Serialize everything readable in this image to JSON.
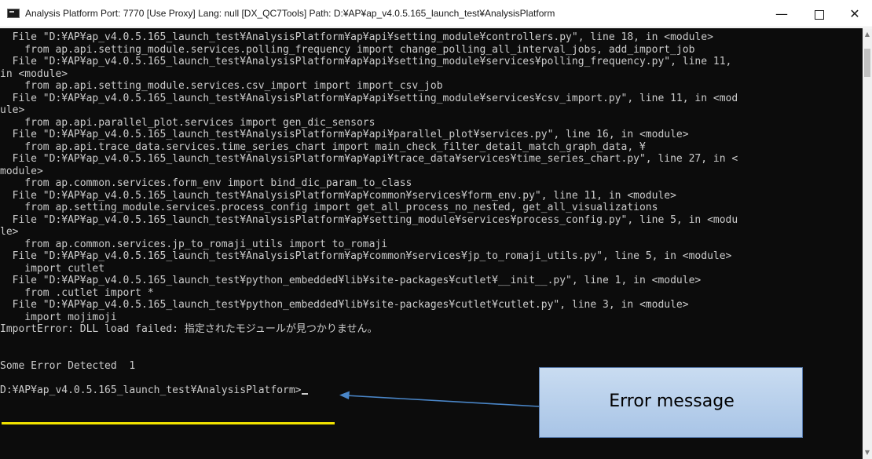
{
  "window": {
    "title": "Analysis Platform   Port: 7770 [Use Proxy]   Lang: null   [DX_QC7Tools]   Path: D:¥AP¥ap_v4.0.5.165_launch_test¥AnalysisPlatform",
    "minimize_glyph": "—",
    "close_glyph": "✕"
  },
  "terminal": {
    "lines": [
      "  File \"D:¥AP¥ap_v4.0.5.165_launch_test¥AnalysisPlatform¥ap¥api¥setting_module¥controllers.py\", line 18, in <module>",
      "    from ap.api.setting_module.services.polling_frequency import change_polling_all_interval_jobs, add_import_job",
      "  File \"D:¥AP¥ap_v4.0.5.165_launch_test¥AnalysisPlatform¥ap¥api¥setting_module¥services¥polling_frequency.py\", line 11,",
      "in <module>",
      "    from ap.api.setting_module.services.csv_import import import_csv_job",
      "  File \"D:¥AP¥ap_v4.0.5.165_launch_test¥AnalysisPlatform¥ap¥api¥setting_module¥services¥csv_import.py\", line 11, in <mod",
      "ule>",
      "    from ap.api.parallel_plot.services import gen_dic_sensors",
      "  File \"D:¥AP¥ap_v4.0.5.165_launch_test¥AnalysisPlatform¥ap¥api¥parallel_plot¥services.py\", line 16, in <module>",
      "    from ap.api.trace_data.services.time_series_chart import main_check_filter_detail_match_graph_data, ¥",
      "  File \"D:¥AP¥ap_v4.0.5.165_launch_test¥AnalysisPlatform¥ap¥api¥trace_data¥services¥time_series_chart.py\", line 27, in <",
      "module>",
      "    from ap.common.services.form_env import bind_dic_param_to_class",
      "  File \"D:¥AP¥ap_v4.0.5.165_launch_test¥AnalysisPlatform¥ap¥common¥services¥form_env.py\", line 11, in <module>",
      "    from ap.setting_module.services.process_config import get_all_process_no_nested, get_all_visualizations",
      "  File \"D:¥AP¥ap_v4.0.5.165_launch_test¥AnalysisPlatform¥ap¥setting_module¥services¥process_config.py\", line 5, in <modu",
      "le>",
      "    from ap.common.services.jp_to_romaji_utils import to_romaji",
      "  File \"D:¥AP¥ap_v4.0.5.165_launch_test¥AnalysisPlatform¥ap¥common¥services¥jp_to_romaji_utils.py\", line 5, in <module>",
      "    import cutlet",
      "  File \"D:¥AP¥ap_v4.0.5.165_launch_test¥python_embedded¥lib¥site-packages¥cutlet¥__init__.py\", line 1, in <module>",
      "    from .cutlet import *",
      "  File \"D:¥AP¥ap_v4.0.5.165_launch_test¥python_embedded¥lib¥site-packages¥cutlet¥cutlet.py\", line 3, in <module>",
      "    import mojimoji",
      "ImportError: DLL load failed: 指定されたモジュールが見つかりません。",
      "",
      "",
      "Some Error Detected  1",
      "",
      "D:¥AP¥ap_v4.0.5.165_launch_test¥AnalysisPlatform>"
    ]
  },
  "annotation": {
    "callout_text": "Error message",
    "underline_color": "#f2e200",
    "callout_fill": "#b8d0ee"
  },
  "colors": {
    "terminal_bg": "#0c0c0c",
    "terminal_fg": "#cccccc",
    "titlebar_bg": "#ffffff"
  },
  "icons": {
    "app": "console-icon",
    "minimize": "minimize-icon",
    "maximize": "maximize-icon",
    "close": "close-icon"
  }
}
